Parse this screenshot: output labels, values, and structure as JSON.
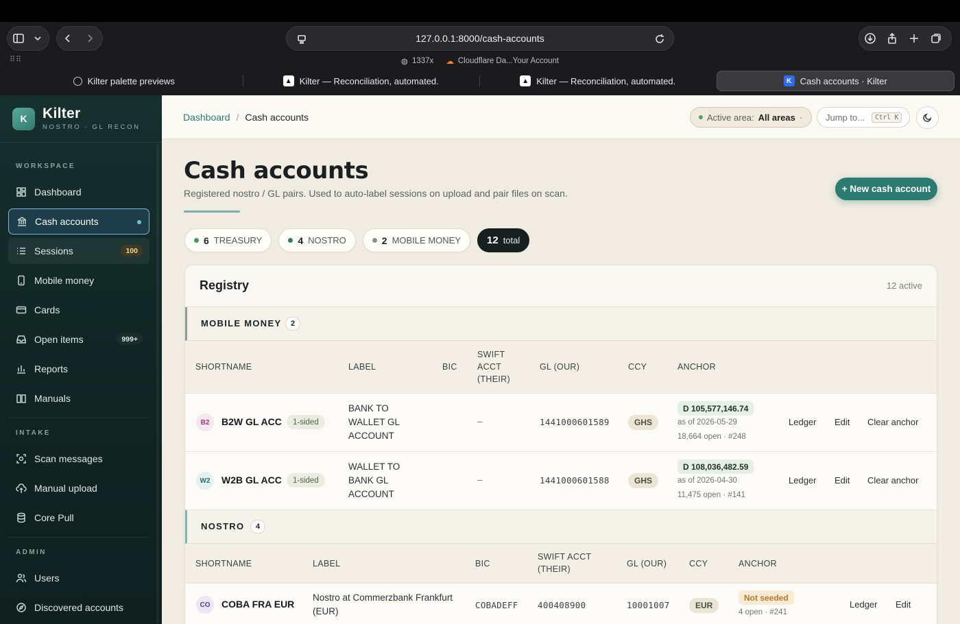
{
  "browser": {
    "url": "127.0.0.1:8000/cash-accounts",
    "bookmarks": [
      "1337x",
      "Cloudflare Da...Your Account"
    ],
    "tabs": [
      {
        "title": "Kilter palette previews"
      },
      {
        "title": "Kilter — Reconciliation, automated."
      },
      {
        "title": "Kilter — Reconciliation, automated."
      },
      {
        "title": "Cash accounts · Kilter"
      }
    ]
  },
  "brand": {
    "name": "Kilter",
    "sub": "NOSTRO · GL RECON",
    "logo": "K"
  },
  "sidebar": {
    "workspace_label": "WORKSPACE",
    "intake_label": "INTAKE",
    "admin_label": "ADMIN",
    "items": {
      "dashboard": "Dashboard",
      "cash_accounts": "Cash accounts",
      "sessions": "Sessions",
      "sessions_badge": "100",
      "mobile_money": "Mobile money",
      "cards": "Cards",
      "open_items": "Open items",
      "open_items_badge": "999+",
      "reports": "Reports",
      "manuals": "Manuals",
      "scan_messages": "Scan messages",
      "manual_upload": "Manual upload",
      "core_pull": "Core Pull",
      "users": "Users",
      "discovered_accounts": "Discovered accounts"
    }
  },
  "topbar": {
    "crumb_home": "Dashboard",
    "crumb_sep": "/",
    "crumb_current": "Cash accounts",
    "area_label": "Active area:",
    "area_value": "All areas",
    "area_caret": "·",
    "jump_label": "Jump to...",
    "jump_kbd": "Ctrl K"
  },
  "page": {
    "title": "Cash accounts",
    "subtitle": "Registered nostro / GL pairs. Used to auto-label sessions on upload and pair files on scan.",
    "new_button": "+ New cash account"
  },
  "chips": [
    {
      "count": "6",
      "label": "TREASURY",
      "color": "#3f9b62"
    },
    {
      "count": "4",
      "label": "NOSTRO",
      "color": "#2f7b70"
    },
    {
      "count": "2",
      "label": "MOBILE MONEY",
      "color": "#8a8f8c"
    },
    {
      "count": "12",
      "label": "total"
    }
  ],
  "registry": {
    "title": "Registry",
    "meta": "12 active",
    "mobile_money": {
      "title": "MOBILE MONEY",
      "count": "2",
      "headers": {
        "shortname": "SHORTNAME",
        "label": "LABEL",
        "bic": "BIC",
        "swift1": "SWIFT",
        "swift2": "ACCT",
        "swift3": "(THEIR)",
        "gl": "GL (OUR)",
        "ccy": "CCY",
        "anchor": "ANCHOR"
      },
      "rows": [
        {
          "avatar": "B2",
          "shortname": "B2W GL ACC",
          "tag": "1-sided",
          "label1": "BANK TO",
          "label2": "WALLET GL",
          "label3": "ACCOUNT",
          "swift": "–",
          "gl": "1441000601589",
          "ccy": "GHS",
          "anchor": "D 105,577,146.74",
          "asof": "as of 2026-05-29",
          "open": "18,664 open · #248",
          "ledger": "Ledger",
          "edit": "Edit",
          "clear": "Clear anchor"
        },
        {
          "avatar": "W2",
          "shortname": "W2B GL ACC",
          "tag": "1-sided",
          "label1": "WALLET TO",
          "label2": "BANK GL",
          "label3": "ACCOUNT",
          "swift": "–",
          "gl": "1441000601588",
          "ccy": "GHS",
          "anchor": "D 108,036,482.59",
          "asof": "as of 2026-04-30",
          "open": "11,475 open · #141",
          "ledger": "Ledger",
          "edit": "Edit",
          "clear": "Clear anchor"
        }
      ]
    },
    "nostro": {
      "title": "NOSTRO",
      "count": "4",
      "headers": {
        "shortname": "SHORTNAME",
        "label": "LABEL",
        "bic": "BIC",
        "swift1": "SWIFT ACCT",
        "swift2": "(THEIR)",
        "gl": "GL (OUR)",
        "ccy": "CCY",
        "anchor": "ANCHOR"
      },
      "rows": [
        {
          "avatar": "CO",
          "shortname": "COBA FRA EUR",
          "label1": "Nostro at Commerzbank Frankfurt",
          "label2": "(EUR)",
          "bic": "COBADEFF",
          "swift": "400408900",
          "gl": "10001007",
          "ccy": "EUR",
          "anchor": "Not seeded",
          "open": "4 open · #241",
          "ledger": "Ledger",
          "edit": "Edit"
        }
      ]
    }
  },
  "colors": {
    "accent": "#2c7b70",
    "sidebar_bg": "#16302d",
    "main_bg": "#f0ece2"
  }
}
